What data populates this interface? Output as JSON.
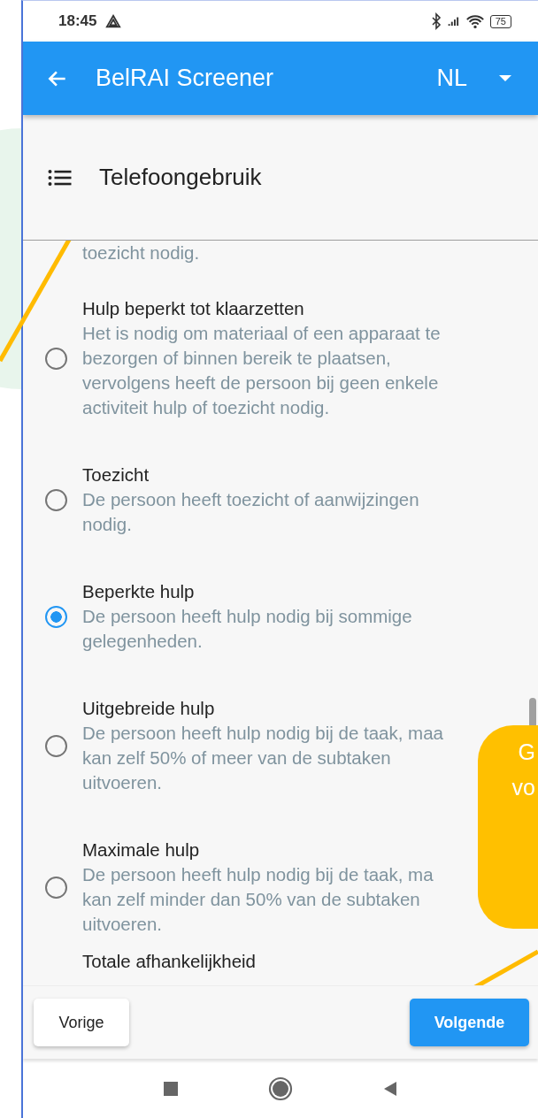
{
  "status_bar": {
    "time": "18:45",
    "battery": "75"
  },
  "app_bar": {
    "title": "BelRAI Screener",
    "language": "NL"
  },
  "section": {
    "title": "Telefoongebruik"
  },
  "top_fragment": "toezicht nodig.",
  "options": [
    {
      "title": "Hulp beperkt tot klaarzetten",
      "lines": [
        "Het is nodig om materiaal of een apparaat te",
        "bezorgen of binnen bereik te plaatsen,",
        "vervolgens heeft de persoon bij geen enkele",
        "activiteit hulp of toezicht nodig."
      ],
      "selected": false
    },
    {
      "title": "Toezicht",
      "lines": [
        "De persoon heeft toezicht of aanwijzingen",
        "nodig."
      ],
      "selected": false
    },
    {
      "title": "Beperkte hulp",
      "lines": [
        "De persoon heeft hulp nodig bij sommige",
        "gelegenheden."
      ],
      "selected": true
    },
    {
      "title": "Uitgebreide hulp",
      "lines": [
        "De persoon heeft hulp nodig bij de taak, maa",
        "kan zelf 50% of meer van de subtaken",
        "uitvoeren."
      ],
      "selected": false
    },
    {
      "title": "Maximale hulp",
      "lines": [
        "De persoon heeft hulp nodig bij de taak, ma",
        "kan zelf minder dan 50% van de subtaken",
        "uitvoeren."
      ],
      "selected": false
    }
  ],
  "bottom_fragment": "Totale afhankelijkheid",
  "buttons": {
    "previous": "Vorige",
    "next": "Volgende"
  },
  "callout": {
    "lines": [
      "G",
      "vo"
    ]
  }
}
